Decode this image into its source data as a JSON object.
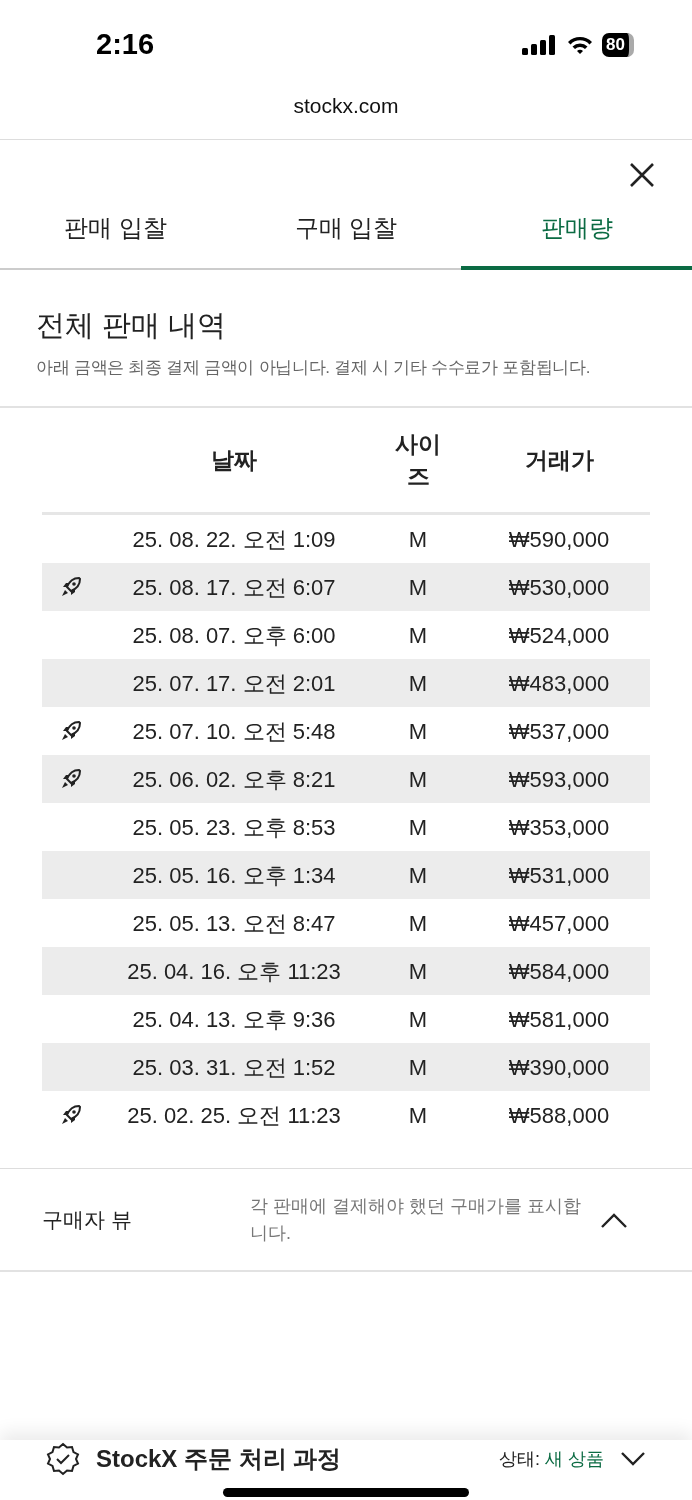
{
  "status_bar": {
    "time": "2:16",
    "battery": "80"
  },
  "browser": {
    "url": "stockx.com"
  },
  "tabs": [
    {
      "label": "판매 입찰",
      "selected": false
    },
    {
      "label": "구매 입찰",
      "selected": false
    },
    {
      "label": "판매량",
      "selected": true
    }
  ],
  "section": {
    "title": "전체 판매 내역",
    "note": "아래 금액은 최종 결제 금액이 아닙니다. 결제 시 기타 수수료가 포함됩니다."
  },
  "table": {
    "columns": [
      "날짜",
      "사이즈",
      "거래가"
    ],
    "rows": [
      {
        "boosted": false,
        "date": "25. 08. 22. 오전 1:09",
        "size": "M",
        "price": "₩590,000"
      },
      {
        "boosted": true,
        "date": "25. 08. 17. 오전 6:07",
        "size": "M",
        "price": "₩530,000"
      },
      {
        "boosted": false,
        "date": "25. 08. 07. 오후 6:00",
        "size": "M",
        "price": "₩524,000"
      },
      {
        "boosted": false,
        "date": "25. 07. 17. 오전 2:01",
        "size": "M",
        "price": "₩483,000"
      },
      {
        "boosted": true,
        "date": "25. 07. 10. 오전 5:48",
        "size": "M",
        "price": "₩537,000"
      },
      {
        "boosted": true,
        "date": "25. 06. 02. 오후 8:21",
        "size": "M",
        "price": "₩593,000"
      },
      {
        "boosted": false,
        "date": "25. 05. 23. 오후 8:53",
        "size": "M",
        "price": "₩353,000"
      },
      {
        "boosted": false,
        "date": "25. 05. 16. 오후 1:34",
        "size": "M",
        "price": "₩531,000"
      },
      {
        "boosted": false,
        "date": "25. 05. 13. 오전 8:47",
        "size": "M",
        "price": "₩457,000"
      },
      {
        "boosted": false,
        "date": "25. 04. 16. 오후 11:23",
        "size": "M",
        "price": "₩584,000"
      },
      {
        "boosted": false,
        "date": "25. 04. 13. 오후 9:36",
        "size": "M",
        "price": "₩581,000"
      },
      {
        "boosted": false,
        "date": "25. 03. 31. 오전 1:52",
        "size": "M",
        "price": "₩390,000"
      },
      {
        "boosted": true,
        "date": "25. 02. 25. 오전 11:23",
        "size": "M",
        "price": "₩588,000"
      }
    ]
  },
  "buyer_view": {
    "label": "구매자 뷰",
    "description": "각 판매에 결제해야 했던 구매가를 표시합니다.",
    "expanded": true
  },
  "footer": {
    "title": "StockX 주문 처리 과정",
    "status_label": "상태:",
    "status_value": "새 상품"
  }
}
